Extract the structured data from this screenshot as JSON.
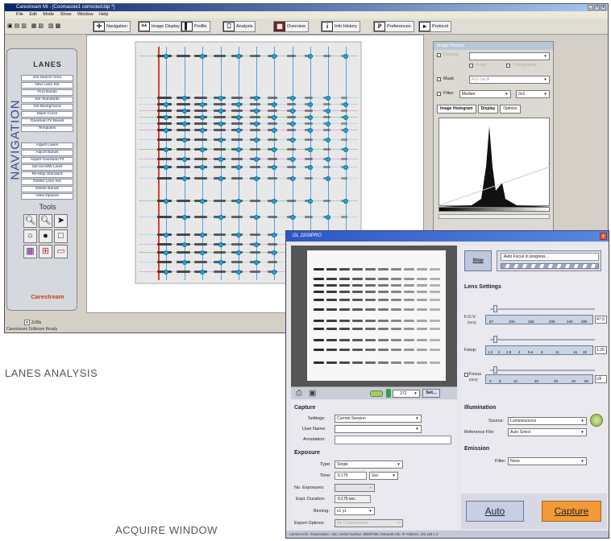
{
  "captions": {
    "lanes": "LANES ANALYSIS",
    "acquire": "ACQUIRE WINDOW"
  },
  "main_window": {
    "title": "Carestream MI - [Coomassie1 corrected.bip *]",
    "menu": [
      "File",
      "Edit",
      "Mode",
      "Show",
      "Window",
      "Help"
    ],
    "toolbar": [
      "Navigation",
      "Image Display",
      "Profile",
      "Analysis",
      "Overview",
      "Info History",
      "Preferences",
      "Protocol"
    ],
    "toolbar_icons": [
      "navigation-icon",
      "image-display-icon",
      "profile-icon",
      "analysis-icon",
      "overview-icon",
      "info-history-icon",
      "preferences-icon",
      "protocol-icon"
    ],
    "nav": {
      "title": "LANES",
      "vertical": "NAVIGATION",
      "buttons": [
        "Set Search Area",
        "New Lane Set",
        "Find Bands",
        "Set Standards",
        "Set Background",
        "Mass Curve",
        "Gaussian Fit Bands",
        "Templates"
      ],
      "buttons2": [
        "Adjust Lanes",
        "Adjust Bands",
        "Adjust Gaussian Fit",
        "Set Iso-MW Lines",
        "Re-Map Standard",
        "Delete Lane Set",
        "Delete Bands",
        "View Options"
      ],
      "tools_title": "Tools",
      "brand": "Carestream"
    },
    "zoom": "3.00x",
    "status": "Carestream Software Ready"
  },
  "image_reader": {
    "title": "Image Reader",
    "overlay": "Overlay",
    "invert": "Invert",
    "transparent": "Transparent",
    "mask": "Mask",
    "mask_value": "ROI Set A",
    "filter": "Filter:",
    "filter_value": "Median",
    "filter_size": "3x3",
    "tabs": [
      "Image Histogram",
      "Display",
      "Options"
    ]
  },
  "acquire": {
    "title": "GL 2200PRO",
    "stop": "Stop",
    "status": "Auto Focus in progress...",
    "lens_title": "Lens Settings",
    "fov_label": "F.O.V.",
    "fov_unit": "(mm)",
    "fov_ticks": [
      "67",
      "100",
      "150",
      "200",
      "240",
      "280"
    ],
    "fov_value": "47.0",
    "fstop_label": "Fstop:",
    "fstop_ticks": [
      "1.2",
      "2",
      "2.8",
      "4",
      "5.6",
      "8",
      "11",
      "16",
      "32"
    ],
    "fstop_value": "1.20",
    "focus_label": "Focus",
    "focus_unit": "(mm)",
    "focus_ticks": [
      "0",
      "8",
      "10",
      "20",
      "30",
      "40",
      "50"
    ],
    "focus_value": "UF",
    "frame_value": "272",
    "set_button": "Set...",
    "capture_title": "Capture",
    "settings_label": "Settings:",
    "settings_value": "Current Session",
    "user_label": "User Name:",
    "annotation_label": "Annotation:",
    "exposure_title": "Exposure",
    "type_label": "Type:",
    "type_value": "Single",
    "time_label": "Time:",
    "time_value": "0.175",
    "time_unit": "Sec",
    "noexp_label": "No. Exposures:",
    "duration_label": "Expt. Duration:",
    "duration_value": "0.175 sec.",
    "binning_label": "Binning:",
    "binning_value": "x1 y1",
    "export_label": "Export Options:",
    "export_value": "No Customization",
    "illum_title": "Illumination",
    "source_label": "Source:",
    "source_value": "Luminescence",
    "ref_label": "Reference File:",
    "ref_value": "Auto Select",
    "emission_title": "Emission",
    "filter_label": "Filter:",
    "filter_value": "None",
    "auto_button": "Auto",
    "capture_button": "Capture",
    "status_bar": "Camera Info:  Temperature: -33c  |  Serial Number: 80697065  |  Network Info:  IP Address: 192.168.1.2"
  },
  "colors": {
    "accent_blue": "#1aa7e2",
    "title_blue": "#1a4f9c",
    "capture_orange": "#f39a36"
  }
}
